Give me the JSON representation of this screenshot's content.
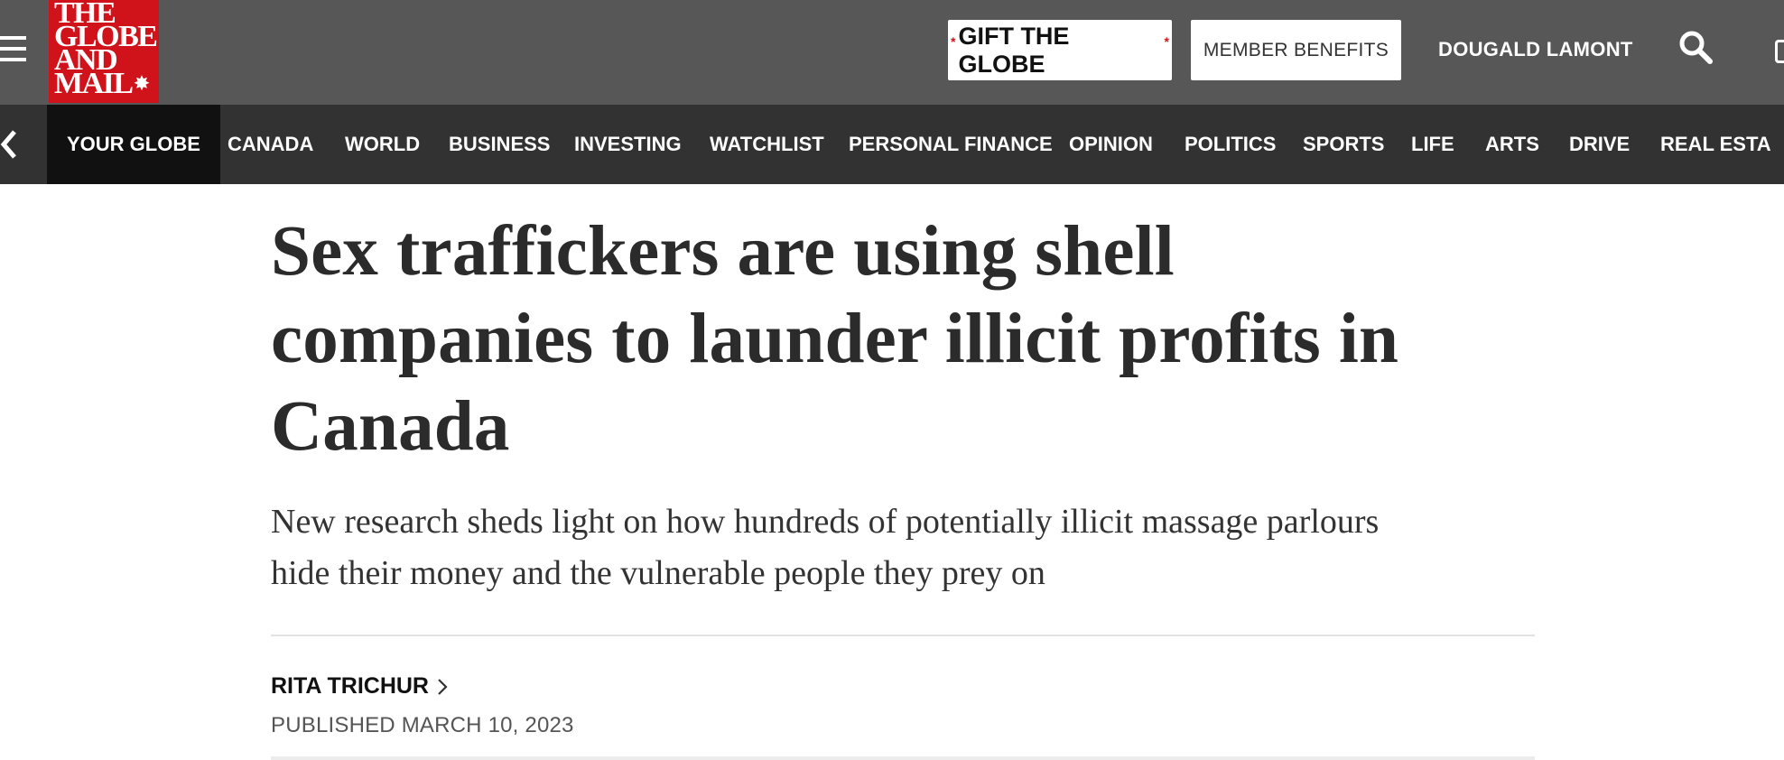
{
  "masthead": {
    "logo_lines": [
      "THE",
      "GLOBE",
      "AND",
      "MAIL"
    ],
    "gift_button": "GIFT THE GLOBE",
    "member_button": "MEMBER BENEFITS",
    "user_name": "DOUGALD LAMONT",
    "icons": [
      "menu-icon",
      "search-icon"
    ],
    "brand_color": "#d0121b"
  },
  "nav": {
    "items": [
      "YOUR GLOBE",
      "CANADA",
      "WORLD",
      "BUSINESS",
      "INVESTING",
      "WATCHLIST",
      "PERSONAL FINANCE",
      "OPINION",
      "POLITICS",
      "SPORTS",
      "LIFE",
      "ARTS",
      "DRIVE",
      "REAL ESTA"
    ],
    "active": "YOUR GLOBE"
  },
  "article": {
    "headline_lines": [
      "Sex traffickers are using shell",
      "companies to launder illicit profits in",
      "Canada"
    ],
    "dek_lines": [
      "New research sheds light on how hundreds of potentially illicit massage parlours",
      "hide their money and the vulnerable people they prey on"
    ],
    "author": "RITA TRICHUR",
    "published": "PUBLISHED MARCH 10, 2023"
  }
}
